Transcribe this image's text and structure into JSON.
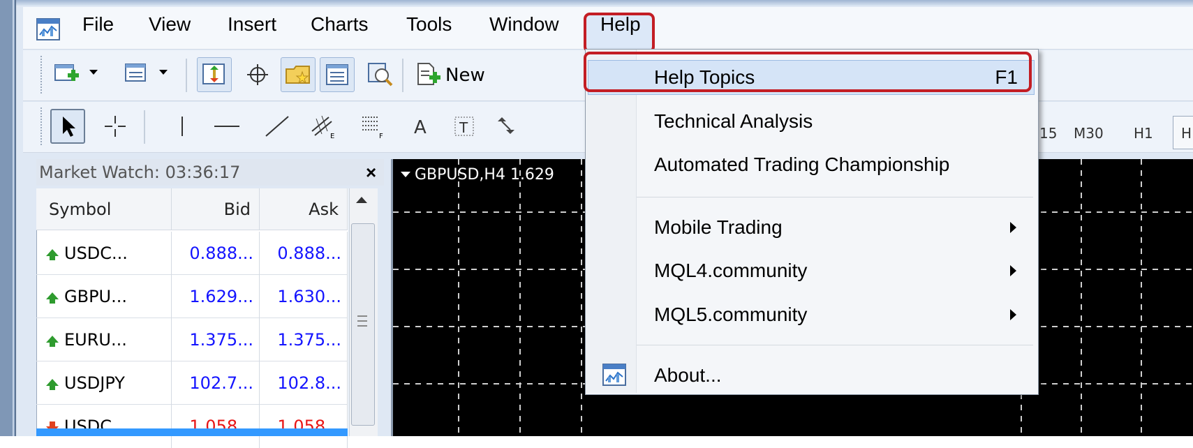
{
  "menubar": {
    "items": [
      "File",
      "View",
      "Insert",
      "Charts",
      "Tools",
      "Window",
      "Help"
    ]
  },
  "toolbar": {
    "new_order_label": "New"
  },
  "timeframes": [
    "15",
    "M30",
    "H1",
    "H"
  ],
  "market_watch": {
    "title": "Market Watch: 03:36:17",
    "close_glyph": "×",
    "columns": [
      "Symbol",
      "Bid",
      "Ask"
    ],
    "rows": [
      {
        "symbol": "USDC...",
        "bid": "0.888...",
        "ask": "0.888...",
        "direction": "up",
        "color": "#1414ff"
      },
      {
        "symbol": "GBPU...",
        "bid": "1.629...",
        "ask": "1.630...",
        "direction": "up",
        "color": "#1414ff"
      },
      {
        "symbol": "EURU...",
        "bid": "1.375...",
        "ask": "1.375...",
        "direction": "up",
        "color": "#1414ff"
      },
      {
        "symbol": "USDJPY",
        "bid": "102.7...",
        "ask": "102.8...",
        "direction": "up",
        "color": "#1414ff"
      },
      {
        "symbol": "USDC...",
        "bid": "1.058...",
        "ask": "1.058...",
        "direction": "down",
        "color": "#e81414"
      }
    ]
  },
  "chart": {
    "title": "GBPUSD,H4  1.629"
  },
  "help_menu": {
    "items": [
      {
        "label": "Help Topics",
        "shortcut": "F1"
      },
      {
        "label": "Technical Analysis"
      },
      {
        "label": "Automated Trading Championship"
      },
      {
        "label": "Mobile Trading",
        "submenu": true
      },
      {
        "label": "MQL4.community",
        "submenu": true
      },
      {
        "label": "MQL5.community",
        "submenu": true
      },
      {
        "label": "About..."
      }
    ]
  },
  "colors": {
    "highlight_border": "#c31d24",
    "hover": "#d5e4f7",
    "price_up": "#1414ff",
    "price_down": "#e81414"
  }
}
